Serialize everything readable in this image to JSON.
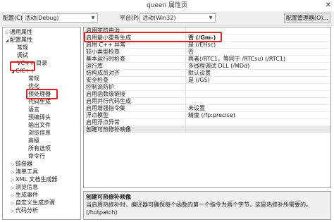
{
  "window": {
    "title": "queen 属性页",
    "close_glyph": "✕"
  },
  "toolbar": {
    "config_label": "配置(C):",
    "config_value": "活动(Debug)",
    "platform_label": "平台(P):",
    "platform_value": "活动(Win32)",
    "config_manager_label": "配置管理器(O)..."
  },
  "tree": {
    "items": [
      {
        "label": "通用属性",
        "arrow": "▷"
      },
      {
        "label": "配置属性",
        "arrow": "◢"
      },
      {
        "label": "常规",
        "arrow": ""
      },
      {
        "label": "调试",
        "arrow": ""
      },
      {
        "label": "VC++ 目录",
        "arrow": ""
      },
      {
        "label": "C/C++",
        "arrow": "◢"
      },
      {
        "label": "常规",
        "arrow": ""
      },
      {
        "label": "优化",
        "arrow": ""
      },
      {
        "label": "预处理器",
        "arrow": ""
      },
      {
        "label": "代码生成",
        "arrow": ""
      },
      {
        "label": "语言",
        "arrow": ""
      },
      {
        "label": "预编译头",
        "arrow": ""
      },
      {
        "label": "输出文件",
        "arrow": ""
      },
      {
        "label": "浏览信息",
        "arrow": ""
      },
      {
        "label": "高级",
        "arrow": ""
      },
      {
        "label": "所有选项",
        "arrow": ""
      },
      {
        "label": "命令行",
        "arrow": ""
      },
      {
        "label": "链接器",
        "arrow": "▷"
      },
      {
        "label": "清单工具",
        "arrow": "▷"
      },
      {
        "label": "XML 文档生成器",
        "arrow": "▷"
      },
      {
        "label": "浏览信息",
        "arrow": "▷"
      },
      {
        "label": "生成事件",
        "arrow": "▷"
      },
      {
        "label": "自定义生成步骤",
        "arrow": "▷"
      },
      {
        "label": "代码分析",
        "arrow": "▷"
      }
    ]
  },
  "properties": {
    "rows": [
      {
        "name": "启用字符串池",
        "value": ""
      },
      {
        "name": "启用最小重新生成",
        "value": "否 (/Gm-)"
      },
      {
        "name": "启用 C++ 异常",
        "value": "是 (/EHsc)"
      },
      {
        "name": "较小类型检查",
        "value": "否"
      },
      {
        "name": "基本运行时检查",
        "value": "两者(/RTC1，等同于 /RTCsu) (/RTC1)"
      },
      {
        "name": "运行库",
        "value": "多线程调试 DLL (/MDd)"
      },
      {
        "name": "结构成员对齐",
        "value": "默认设置"
      },
      {
        "name": "安全检查",
        "value": "是 (/GS)"
      },
      {
        "name": "控制流防护",
        "value": ""
      },
      {
        "name": "启用函数级链接",
        "value": ""
      },
      {
        "name": "启用并行代码生成",
        "value": ""
      },
      {
        "name": "启用增强指令集",
        "value": "未设置"
      },
      {
        "name": "浮点模型",
        "value": "精度 (/fp:precise)"
      },
      {
        "name": "启用浮点异常",
        "value": ""
      },
      {
        "name": "创建可热修补映像",
        "value": ""
      }
    ]
  },
  "description": {
    "title": "创建可热修补映像",
    "body": "当启用热修补时，编译器可确保每个函数的第一个指令为两个字节，这是热修补所需要的。(/hotpatch)"
  },
  "colors": {
    "highlight": "#e02020",
    "selection": "#e8e8e8"
  }
}
